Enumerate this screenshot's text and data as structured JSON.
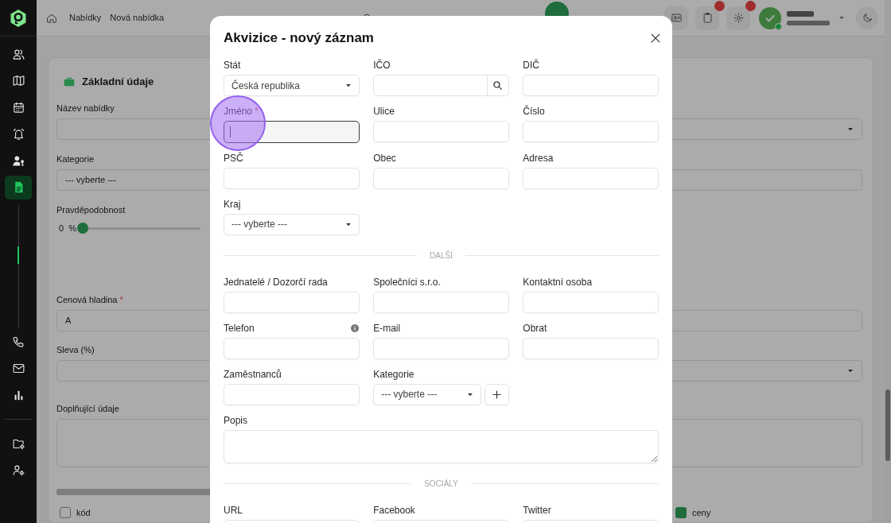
{
  "sidebar": {
    "main": [
      {
        "selected": false
      },
      {
        "selected": false
      },
      {
        "selected": false
      },
      {
        "selected": false
      },
      {
        "selected": false
      },
      {
        "selected": true
      }
    ],
    "tools": [
      {
        "selected": false
      },
      {
        "selected": false
      },
      {
        "selected": false
      }
    ],
    "settings": [
      {
        "selected": false
      },
      {
        "selected": false
      }
    ]
  },
  "top_bar": {
    "breadcrumb": [
      "Nabídky",
      "Nová nabídka"
    ],
    "icon_buttons": [
      {
        "badge": false
      },
      {
        "badge": true
      },
      {
        "badge": true
      }
    ],
    "user": {
      "online": true
    }
  },
  "page": {
    "section_title": "Základní údaje",
    "fields": [
      {
        "kind": "select",
        "label": "Název nabídky"
      },
      {
        "kind": "input",
        "label": "Kategorie",
        "value": "--- vyberte ---"
      },
      {
        "kind": "slider",
        "label": "Pravděpodobnost",
        "value": "0",
        "unit": "%",
        "level": 0
      },
      {
        "kind": "input",
        "label": "Cenová hladina",
        "required_mark": "*",
        "value": "A"
      },
      {
        "kind": "select",
        "label": "Sleva (%)"
      },
      {
        "kind": "textarea",
        "label": "Doplňující údaje"
      }
    ],
    "options": [
      {
        "label": "kód",
        "checked": false
      },
      {
        "label": "ceny",
        "checked": true
      }
    ]
  },
  "modal": {
    "title": "Akvizice - nový záznam",
    "sections": [
      {
        "fields": [
          {
            "kind": "select",
            "label": "Stát",
            "value": "Česká republika",
            "focused": false,
            "info": false
          },
          {
            "kind": "search",
            "label": "IČO",
            "focused": false,
            "info": false
          },
          {
            "kind": "input",
            "label": "DIČ",
            "focused": false,
            "info": false
          },
          {
            "kind": "input",
            "label": "Jméno",
            "required_mark": "*",
            "focused": true,
            "info": false
          },
          {
            "kind": "input",
            "label": "Ulice",
            "focused": false,
            "info": false
          },
          {
            "kind": "input",
            "label": "Číslo",
            "focused": false,
            "info": false
          },
          {
            "kind": "input",
            "label": "PSČ",
            "focused": false,
            "info": false
          },
          {
            "kind": "input",
            "label": "Obec",
            "focused": false,
            "info": false
          },
          {
            "kind": "input",
            "label": "Adresa",
            "focused": false,
            "info": false
          },
          {
            "kind": "select",
            "label": "Kraj",
            "value": "--- vyberte ---",
            "focused": false,
            "info": false
          }
        ]
      },
      {
        "heading": "DALŠÍ",
        "fields": [
          {
            "kind": "input",
            "label": "Jednatelé / Dozorčí rada",
            "focused": false,
            "info": false
          },
          {
            "kind": "input",
            "label": "Společníci s.r.o.",
            "focused": false,
            "info": false
          },
          {
            "kind": "input",
            "label": "Kontaktní osoba",
            "focused": false,
            "info": false
          },
          {
            "kind": "input",
            "label": "Telefon",
            "focused": false,
            "info": true
          },
          {
            "kind": "input",
            "label": "E-mail",
            "focused": false,
            "info": false
          },
          {
            "kind": "input",
            "label": "Obrat",
            "focused": false,
            "info": false
          },
          {
            "kind": "input",
            "label": "Zaměstnanců",
            "focused": false,
            "info": false
          },
          {
            "kind": "select_add",
            "label": "Kategorie",
            "value": "--- vyberte ---",
            "focused": false,
            "info": false
          },
          {
            "kind": "textarea",
            "label": "Popis",
            "focused": false,
            "info": false
          }
        ]
      },
      {
        "heading": "SOCIÁLY",
        "fields": [
          {
            "kind": "input",
            "label": "URL",
            "focused": false,
            "info": false
          },
          {
            "kind": "input",
            "label": "Facebook",
            "focused": false,
            "info": false
          },
          {
            "kind": "input",
            "label": "Twitter",
            "focused": false,
            "info": false
          }
        ]
      }
    ]
  }
}
